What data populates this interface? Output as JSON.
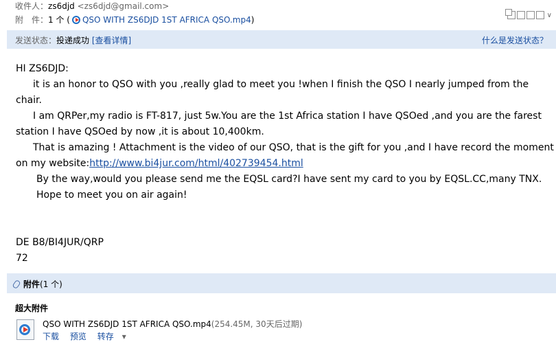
{
  "header": {
    "recipient_label": "收件人：",
    "recipient_name": "zs6djd",
    "recipient_email": "<zs6djd@gmail.com>",
    "attachment_label": "附　件：",
    "attachment_count": "1 个 (",
    "attachment_link": "QSO WITH ZS6DJD 1ST AFRICA QSO.mp4",
    "attachment_close": ")"
  },
  "status": {
    "label": "发送状态：",
    "value": "投递成功",
    "details_link": "[查看详情]",
    "help_link": "什么是发送状态？"
  },
  "body": {
    "greeting": "HI ZS6DJD:",
    "p1": "it is an honor to QSO with you ,really glad to meet you !when I finish the QSO I nearly jumped from the chair.",
    "p2": "I am QRPer,my radio is FT-817, just 5w.You are the 1st Africa station I have QSOed ,and you are the farest station I have QSOed by now ,it is about 10,400km.",
    "p3": "That is amazing ! Attachment is the video of our QSO, that is the gift for you ,and I have record the moment on my website:",
    "p3_link": "http://www.bi4jur.com/html/402739454.html",
    "p4": "By the way,would you please send me the EQSL card?I have sent my card to you by EQSL.CC,many TNX.",
    "p5": "Hope to meet you on air again!",
    "sign1": "DE B8/BI4JUR/QRP",
    "sign2": "72"
  },
  "attachments": {
    "title": "附件",
    "count": "(1 个)",
    "section": "超大附件",
    "file_name": "QSO WITH ZS6DJD 1ST AFRICA QSO.mp4",
    "file_meta": "(254.45M, 30天后过期)",
    "download": "下载",
    "preview": "预览",
    "save": "转存",
    "save_caret": "▾"
  },
  "colors": {
    "accent_bg": "#dfe9f6",
    "link": "#1a4fa0"
  }
}
